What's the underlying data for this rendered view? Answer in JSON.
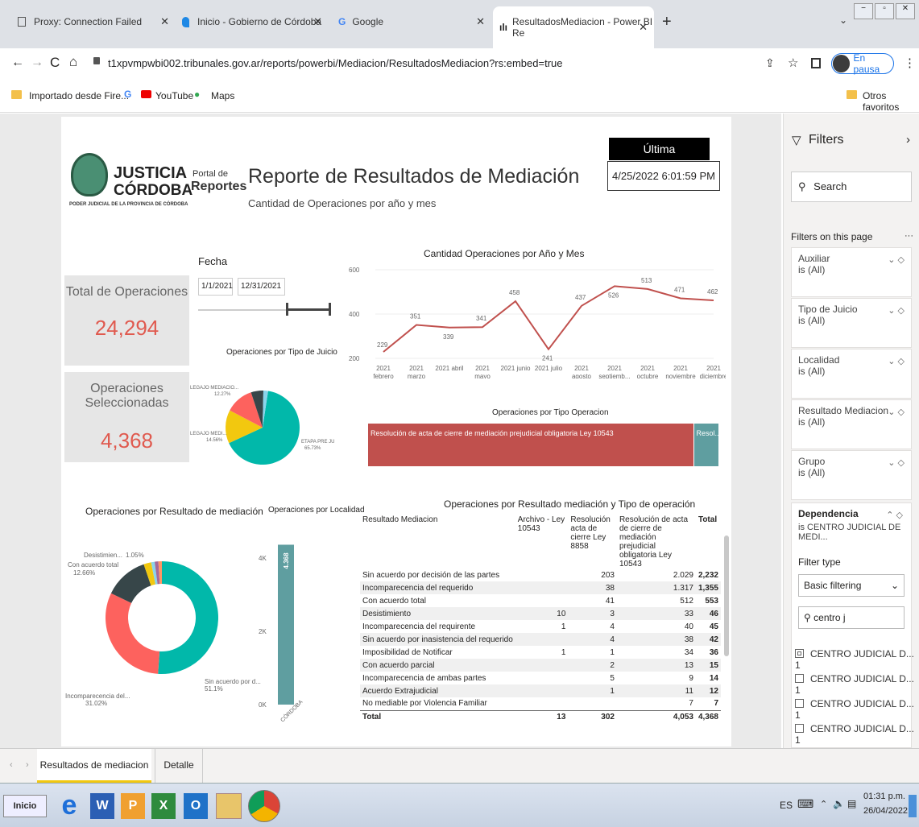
{
  "browser": {
    "tabs": [
      {
        "title": "Proxy: Connection Failed"
      },
      {
        "title": "Inicio - Gobierno de Córdoba"
      },
      {
        "title": "Google"
      },
      {
        "title": "ResultadosMediacion - Power BI Re"
      }
    ],
    "url": "t1xpvmpwbi002.tribunales.gov.ar/reports/powerbi/Mediacion/ResultadosMediacion?rs:embed=true",
    "profile": "En pausa",
    "bookmarks": [
      "Importado desde Fire...",
      "YouTube",
      "Maps"
    ],
    "other_bookmarks": "Otros favoritos"
  },
  "report": {
    "logo": {
      "line1": "JUSTICIA",
      "line2": "CÓRDOBA",
      "portal1": "Portal de",
      "portal2": "Reportes",
      "sub": "PODER JUDICIAL DE LA PROVINCIA DE CÓRDOBA"
    },
    "title": "Reporte de Resultados de Mediación",
    "subtitle": "Cantidad de Operaciones por año y mes",
    "update_label": "Última Actualización",
    "update_value": "4/25/2022 6:01:59 PM",
    "kpi_total_label": "Total de Operaciones",
    "kpi_total_value": "24,294",
    "kpi_sel_label": "Operaciones  Seleccionadas",
    "kpi_sel_value": "4,368",
    "fecha_label": "Fecha",
    "fecha_from": "1/1/2021",
    "fecha_to": "12/31/2021",
    "bar_rest_label": "Resol..."
  },
  "chart_data": [
    {
      "type": "line",
      "title": "Cantidad Operaciones por Año y Mes",
      "categories": [
        "2021 febrero",
        "2021 marzo",
        "2021 abril",
        "2021 mayo",
        "2021 junio",
        "2021 julio",
        "2021 agosto",
        "2021 septiemb...",
        "2021 octubre",
        "2021 noviembre",
        "2021 diciembre"
      ],
      "cat_line1": [
        "2021",
        "2021",
        "2021 abril",
        "2021",
        "2021 junio",
        "2021 julio",
        "2021",
        "2021",
        "2021",
        "2021",
        "2021"
      ],
      "cat_line2": [
        "febrero",
        "marzo",
        "",
        "mayo",
        "",
        "",
        "agosto",
        "septiemb...",
        "octubre",
        "noviembre",
        "diciembre"
      ],
      "values": [
        229,
        351,
        339,
        341,
        458,
        241,
        437,
        526,
        513,
        471,
        462
      ],
      "ylim": [
        200,
        600
      ],
      "yticks": [
        "200",
        "400",
        "600"
      ],
      "color": "#c0504d"
    },
    {
      "type": "pie",
      "title": "Operaciones por Tipo de Juicio",
      "slices": [
        {
          "label": "ETAPA PRE JU...",
          "pct_label": "65.73%",
          "value": 65.73,
          "color": "#01b8aa"
        },
        {
          "label": "LEGAJO MEDI...",
          "pct_label": "14.56%",
          "value": 14.56,
          "color": "#f2c80f"
        },
        {
          "label": "LEGAJO MEDIACIO...",
          "pct_label": "12.27%",
          "value": 12.27,
          "color": "#fd625e"
        },
        {
          "label": "",
          "pct_label": "",
          "value": 5.4,
          "color": "#374649"
        },
        {
          "label": "",
          "pct_label": "",
          "value": 2.04,
          "color": "#8ad4eb"
        }
      ]
    },
    {
      "type": "bar",
      "title": "Operaciones por Tipo Operacion",
      "categories": [
        "Resolución de acta de cierre de mediación prejudicial obligatoria Ley 10543",
        "Resol..."
      ],
      "values": [
        4053,
        315
      ],
      "colors": [
        "#c0504d",
        "#5f9ea0"
      ]
    },
    {
      "type": "pie",
      "title": "Operaciones por Resultado de mediación",
      "slices": [
        {
          "label": "Sin acuerdo por d...",
          "pct_label": "51.1%",
          "value": 51.1,
          "color": "#01b8aa"
        },
        {
          "label": "Incomparecencia del...",
          "pct_label": "31.02%",
          "value": 31.02,
          "color": "#fd625e"
        },
        {
          "label": "Con acuerdo total",
          "pct_label": "12.66%",
          "value": 12.66,
          "color": "#374649"
        },
        {
          "label": "",
          "pct_label": "",
          "value": 2.17,
          "color": "#f2c80f"
        },
        {
          "label": "",
          "pct_label": "",
          "value": 1.0,
          "color": "#8ad4eb"
        },
        {
          "label": "Desistimien...",
          "pct_label": "1.05%",
          "value": 1.05,
          "color": "#a66999"
        },
        {
          "label": "",
          "pct_label": "",
          "value": 1.0,
          "color": "#fe9666"
        }
      ]
    },
    {
      "type": "bar",
      "title": "Operaciones por Localidad",
      "categories": [
        "CÓRDOBA"
      ],
      "values": [
        4368
      ],
      "value_label": "4.368",
      "ylim": [
        0,
        4400
      ],
      "yticks": [
        "0K",
        "2K",
        "4K"
      ],
      "color": "#5f9ea0"
    }
  ],
  "table": {
    "title": "Operaciones por Resultado mediación y Tipo de operación",
    "headers": [
      "Resultado Mediacion",
      "Archivo - Ley 10543",
      "Resolución acta de cierre Ley 8858",
      "Resolución de acta de cierre de mediación prejudicial obligatoria Ley 10543",
      "Total"
    ],
    "rows": [
      [
        "Sin acuerdo por decisión de las partes",
        "",
        "203",
        "2.029",
        "2,232"
      ],
      [
        "Incomparecencia del requerido",
        "",
        "38",
        "1.317",
        "1,355"
      ],
      [
        "Con acuerdo total",
        "",
        "41",
        "512",
        "553"
      ],
      [
        "Desistimiento",
        "10",
        "3",
        "33",
        "46"
      ],
      [
        "Incomparecencia del requirente",
        "1",
        "4",
        "40",
        "45"
      ],
      [
        "Sin acuerdo por inasistencia del requerido",
        "",
        "4",
        "38",
        "42"
      ],
      [
        "Imposibilidad de Notificar",
        "1",
        "1",
        "34",
        "36"
      ],
      [
        "Con acuerdo parcial",
        "",
        "2",
        "13",
        "15"
      ],
      [
        "Incomparecencia de ambas partes",
        "",
        "5",
        "9",
        "14"
      ],
      [
        "Acuerdo Extrajudicial",
        "",
        "1",
        "11",
        "12"
      ],
      [
        "No mediable por Violencia Familiar",
        "",
        "",
        "7",
        "7"
      ]
    ],
    "total": [
      "Total",
      "13",
      "302",
      "4,053",
      "4,368"
    ]
  },
  "filters": {
    "title": "Filters",
    "search": "Search",
    "on_page": "Filters on this page",
    "cards": [
      {
        "name": "Auxiliar",
        "value": "is (All)"
      },
      {
        "name": "Tipo de Juicio",
        "value": "is (All)"
      },
      {
        "name": "Localidad",
        "value": "is (All)"
      },
      {
        "name": "Resultado Mediacion",
        "value": "is (All)"
      },
      {
        "name": "Grupo",
        "value": "is (All)"
      }
    ],
    "dep_name": "Dependencia",
    "dep_value": "is CENTRO JUDICIAL DE MEDI...",
    "filter_type_label": "Filter type",
    "filter_type_value": "Basic filtering",
    "search_value": "centro j",
    "options": [
      "CENTRO JUDICIAL D... 1",
      "CENTRO JUDICIAL D... 1",
      "CENTRO JUDICIAL D... 1",
      "CENTRO JUDICIAL D... 1"
    ]
  },
  "pages": [
    "Resultados de mediacion",
    "Detalle"
  ],
  "taskbar": {
    "start": "Inicio",
    "lang": "ES",
    "time": "01:31 p.m.",
    "date": "26/04/2022"
  }
}
